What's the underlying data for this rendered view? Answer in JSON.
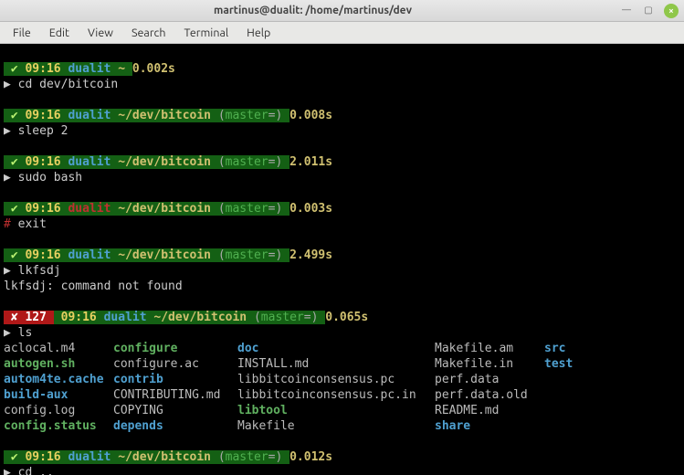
{
  "title": "martinus@dualit: /home/martinus/dev",
  "menu": [
    "File",
    "Edit",
    "View",
    "Search",
    "Terminal",
    "Help"
  ],
  "time": "09:16",
  "host": "dualit",
  "branch": "master",
  "eq": "=",
  "home_path": "~",
  "bitcoin_path": "~/dev/bitcoin",
  "blocks": [
    {
      "dur": "0.002s",
      "cmd": "cd dev/bitcoin"
    },
    {
      "dur": "0.008s",
      "cmd": "sleep 2"
    },
    {
      "dur": "2.011s",
      "cmd": "sudo bash"
    },
    {
      "dur": "0.003s",
      "cmd": "exit"
    },
    {
      "dur": "2.499s",
      "cmd": "lkfsdj"
    },
    {
      "dur": "0.065s",
      "cmd": "ls"
    },
    {
      "dur": "0.012s",
      "cmd": "cd .."
    }
  ],
  "errno": "127",
  "errline": "lkfsdj: command not found",
  "ls": {
    "r1": {
      "a": "aclocal.m4",
      "b": "configure",
      "c": "doc",
      "d": "Makefile.am",
      "e": "src"
    },
    "r2": {
      "a": "autogen.sh",
      "b": "configure.ac",
      "c": "INSTALL.md",
      "d": "Makefile.in",
      "e": "test"
    },
    "r3": {
      "a": "autom4te.cache",
      "b": "contrib",
      "c": "libbitcoinconsensus.pc",
      "d": "perf.data"
    },
    "r4": {
      "a": "build-aux",
      "b": "CONTRIBUTING.md",
      "c": "libbitcoinconsensus.pc.in",
      "d": "perf.data.old"
    },
    "r5": {
      "a": "config.log",
      "b": "COPYING",
      "c": "libtool",
      "d": "README.md"
    },
    "r6": {
      "a": "config.status",
      "b": "depends",
      "c": "Makefile",
      "d": "share"
    }
  }
}
